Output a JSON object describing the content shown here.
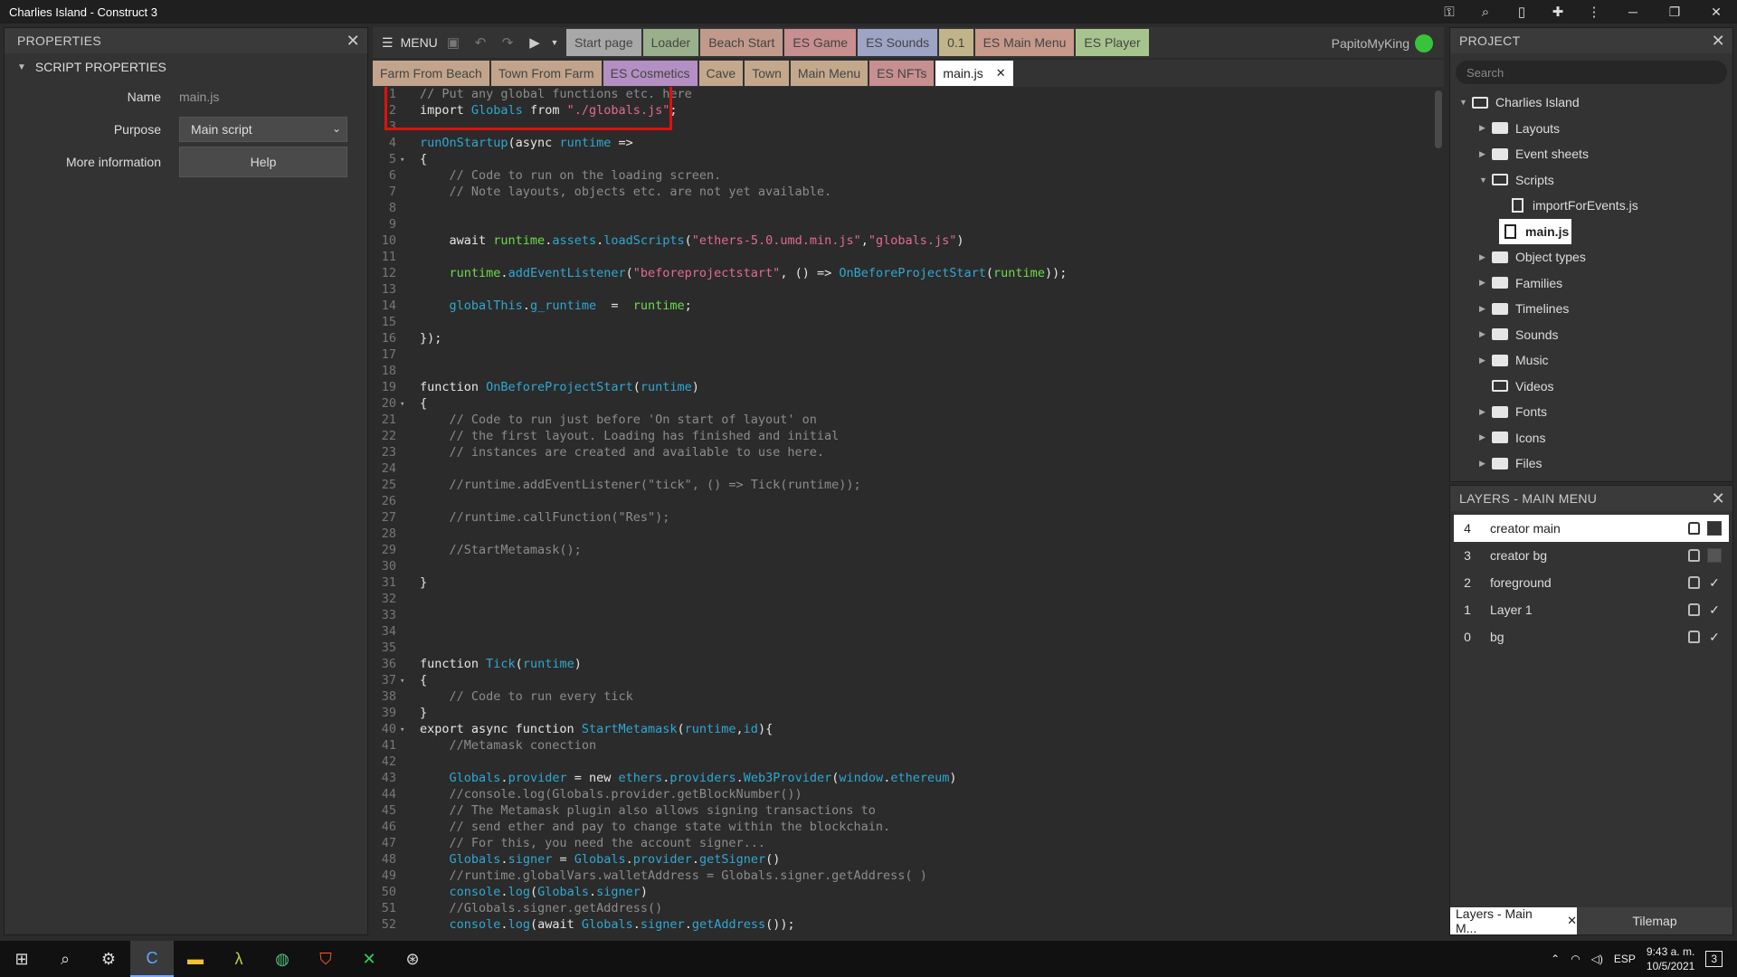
{
  "window": {
    "title": "Charlies Island - Construct 3"
  },
  "properties": {
    "header": "PROPERTIES",
    "section": "SCRIPT PROPERTIES",
    "name_label": "Name",
    "name_value": "main.js",
    "purpose_label": "Purpose",
    "purpose_value": "Main script",
    "more_label": "More information",
    "help_label": "Help"
  },
  "toolbar": {
    "menu_label": "MENU",
    "tabs": [
      {
        "label": "Start page",
        "color": "#a8a8a8"
      },
      {
        "label": "Loader",
        "color": "#9ab08c"
      },
      {
        "label": "Beach Start",
        "color": "#c29a8c"
      },
      {
        "label": "ES Game",
        "color": "#c78f8f"
      },
      {
        "label": "ES Sounds",
        "color": "#9ea4c4"
      },
      {
        "label": "0.1",
        "color": "#c2b48a"
      },
      {
        "label": "ES Main Menu",
        "color": "#c79a8c"
      },
      {
        "label": "ES Player",
        "color": "#a8c48e"
      }
    ],
    "user": "PapitoMyKing"
  },
  "tabs2": [
    {
      "label": "Farm From Beach",
      "color": "#c2a48c",
      "text": "#444"
    },
    {
      "label": "Town From Farm",
      "color": "#c2a48c",
      "text": "#444"
    },
    {
      "label": "ES Cosmetics",
      "color": "#b48fc4",
      "text": "#444"
    },
    {
      "label": "Cave",
      "color": "#c4a88c",
      "text": "#444"
    },
    {
      "label": "Town",
      "color": "#c4a88c",
      "text": "#444"
    },
    {
      "label": "Main Menu",
      "color": "#c4a88c",
      "text": "#444"
    },
    {
      "label": "ES NFTs",
      "color": "#c78f8f",
      "text": "#444"
    }
  ],
  "active_tab": {
    "label": "main.js",
    "close": "✕"
  },
  "code_lines": [
    {
      "n": "1",
      "fold": "",
      "html": "<span class=\"c\">// Put any global functions etc. here</span>"
    },
    {
      "n": "2",
      "fold": "",
      "html": "import <span class=\"f\">Globals</span> from <span class=\"s\">\"./globals.js\"</span>;"
    },
    {
      "n": "3",
      "fold": "",
      "html": ""
    },
    {
      "n": "4",
      "fold": "",
      "html": "<span class=\"f\">runOnStartup</span>(async <span class=\"f\">runtime</span> =&gt;"
    },
    {
      "n": "5",
      "fold": "▾",
      "html": "{"
    },
    {
      "n": "6",
      "fold": "",
      "html": "    <span class=\"c\">// Code to run on the loading screen.</span>"
    },
    {
      "n": "7",
      "fold": "",
      "html": "    <span class=\"c\">// Note layouts, objects etc. are not yet available.</span>"
    },
    {
      "n": "8",
      "fold": "",
      "html": ""
    },
    {
      "n": "9",
      "fold": "",
      "html": ""
    },
    {
      "n": "10",
      "fold": "",
      "html": "    await <span class=\"g\">runtime</span>.<span class=\"f\">assets</span>.<span class=\"f\">loadScripts</span>(<span class=\"s\">\"ethers-5.0.umd.min.js\"</span>,<span class=\"s\">\"globals.js\"</span>)"
    },
    {
      "n": "11",
      "fold": "",
      "html": ""
    },
    {
      "n": "12",
      "fold": "",
      "html": "    <span class=\"g\">runtime</span>.<span class=\"f\">addEventListener</span>(<span class=\"s\">\"beforeprojectstart\"</span>, () =&gt; <span class=\"f\">OnBeforeProjectStart</span>(<span class=\"g\">runtime</span>));"
    },
    {
      "n": "13",
      "fold": "",
      "html": ""
    },
    {
      "n": "14",
      "fold": "",
      "html": "    <span class=\"f\">globalThis</span>.<span class=\"f\">g_runtime</span>  =  <span class=\"g\">runtime</span>;"
    },
    {
      "n": "15",
      "fold": "",
      "html": ""
    },
    {
      "n": "16",
      "fold": "",
      "html": "});"
    },
    {
      "n": "17",
      "fold": "",
      "html": ""
    },
    {
      "n": "18",
      "fold": "",
      "html": ""
    },
    {
      "n": "19",
      "fold": "",
      "html": "function <span class=\"f\">OnBeforeProjectStart</span>(<span class=\"f\">runtime</span>)"
    },
    {
      "n": "20",
      "fold": "▾",
      "html": "{"
    },
    {
      "n": "21",
      "fold": "",
      "html": "    <span class=\"c\">// Code to run just before 'On start of layout' on</span>"
    },
    {
      "n": "22",
      "fold": "",
      "html": "    <span class=\"c\">// the first layout. Loading has finished and initial</span>"
    },
    {
      "n": "23",
      "fold": "",
      "html": "    <span class=\"c\">// instances are created and available to use here.</span>"
    },
    {
      "n": "24",
      "fold": "",
      "html": ""
    },
    {
      "n": "25",
      "fold": "",
      "html": "    <span class=\"c\">//runtime.addEventListener(\"tick\", () =&gt; Tick(runtime));</span>"
    },
    {
      "n": "26",
      "fold": "",
      "html": ""
    },
    {
      "n": "27",
      "fold": "",
      "html": "    <span class=\"c\">//runtime.callFunction(\"Res\");</span>"
    },
    {
      "n": "28",
      "fold": "",
      "html": ""
    },
    {
      "n": "29",
      "fold": "",
      "html": "    <span class=\"c\">//StartMetamask();</span>"
    },
    {
      "n": "30",
      "fold": "",
      "html": ""
    },
    {
      "n": "31",
      "fold": "",
      "html": "}"
    },
    {
      "n": "32",
      "fold": "",
      "html": ""
    },
    {
      "n": "33",
      "fold": "",
      "html": ""
    },
    {
      "n": "34",
      "fold": "",
      "html": ""
    },
    {
      "n": "35",
      "fold": "",
      "html": ""
    },
    {
      "n": "36",
      "fold": "",
      "html": "function <span class=\"f\">Tick</span>(<span class=\"f\">runtime</span>)"
    },
    {
      "n": "37",
      "fold": "▾",
      "html": "{"
    },
    {
      "n": "38",
      "fold": "",
      "html": "    <span class=\"c\">// Code to run every tick</span>"
    },
    {
      "n": "39",
      "fold": "",
      "html": "}"
    },
    {
      "n": "40",
      "fold": "▾",
      "html": "export async function <span class=\"f\">StartMetamask</span>(<span class=\"f\">runtime</span>,<span class=\"f\">id</span>){"
    },
    {
      "n": "41",
      "fold": "",
      "html": "    <span class=\"c\">//Metamask conection</span>"
    },
    {
      "n": "42",
      "fold": "",
      "html": ""
    },
    {
      "n": "43",
      "fold": "",
      "html": "    <span class=\"f\">Globals</span>.<span class=\"f\">provider</span> = new <span class=\"f\">ethers</span>.<span class=\"f\">providers</span>.<span class=\"f\">Web3Provider</span>(<span class=\"f\">window</span>.<span class=\"f\">ethereum</span>)"
    },
    {
      "n": "44",
      "fold": "",
      "html": "    <span class=\"c\">//console.log(Globals.provider.getBlockNumber())</span>"
    },
    {
      "n": "45",
      "fold": "",
      "html": "    <span class=\"c\">// The Metamask plugin also allows signing transactions to</span>"
    },
    {
      "n": "46",
      "fold": "",
      "html": "    <span class=\"c\">// send ether and pay to change state within the blockchain.</span>"
    },
    {
      "n": "47",
      "fold": "",
      "html": "    <span class=\"c\">// For this, you need the account signer...</span>"
    },
    {
      "n": "48",
      "fold": "",
      "html": "    <span class=\"f\">Globals</span>.<span class=\"f\">signer</span> = <span class=\"f\">Globals</span>.<span class=\"f\">provider</span>.<span class=\"f\">getSigner</span>()"
    },
    {
      "n": "49",
      "fold": "",
      "html": "    <span class=\"c\">//runtime.globalVars.walletAddress = Globals.signer.getAddress( )</span>"
    },
    {
      "n": "50",
      "fold": "",
      "html": "    <span class=\"f\">console</span>.<span class=\"f\">log</span>(<span class=\"f\">Globals</span>.<span class=\"f\">signer</span>)"
    },
    {
      "n": "51",
      "fold": "",
      "html": "    <span class=\"c\">//Globals.signer.getAddress()</span>"
    },
    {
      "n": "52",
      "fold": "",
      "html": "    <span class=\"f\">console</span>.<span class=\"f\">log</span>(await <span class=\"f\">Globals</span>.<span class=\"f\">signer</span>.<span class=\"f\">getAddress</span>());"
    }
  ],
  "project": {
    "header": "PROJECT",
    "search_placeholder": "Search",
    "items": [
      {
        "label": "Charlies Island",
        "type": "folder-open",
        "depth": 0,
        "arrow": "▼"
      },
      {
        "label": "Layouts",
        "type": "folder",
        "depth": 1,
        "arrow": "▶"
      },
      {
        "label": "Event sheets",
        "type": "folder",
        "depth": 1,
        "arrow": "▶"
      },
      {
        "label": "Scripts",
        "type": "folder-open",
        "depth": 1,
        "arrow": "▼"
      },
      {
        "label": "importForEvents.js",
        "type": "file",
        "depth": 2,
        "arrow": ""
      },
      {
        "label": "main.js",
        "type": "file",
        "depth": 2,
        "arrow": "",
        "selected": true
      },
      {
        "label": "Object types",
        "type": "folder",
        "depth": 1,
        "arrow": "▶"
      },
      {
        "label": "Families",
        "type": "folder",
        "depth": 1,
        "arrow": "▶"
      },
      {
        "label": "Timelines",
        "type": "folder",
        "depth": 1,
        "arrow": "▶"
      },
      {
        "label": "Sounds",
        "type": "folder",
        "depth": 1,
        "arrow": "▶"
      },
      {
        "label": "Music",
        "type": "folder",
        "depth": 1,
        "arrow": "▶"
      },
      {
        "label": "Videos",
        "type": "folder-open",
        "depth": 1,
        "arrow": ""
      },
      {
        "label": "Fonts",
        "type": "folder",
        "depth": 1,
        "arrow": "▶"
      },
      {
        "label": "Icons",
        "type": "folder",
        "depth": 1,
        "arrow": "▶"
      },
      {
        "label": "Files",
        "type": "folder",
        "depth": 1,
        "arrow": "▶"
      }
    ]
  },
  "layers": {
    "header": "LAYERS - MAIN MENU",
    "rows": [
      {
        "num": "4",
        "name": "creator main",
        "visible": false,
        "selected": true
      },
      {
        "num": "3",
        "name": "creator bg",
        "visible": false,
        "selected": false
      },
      {
        "num": "2",
        "name": "foreground",
        "visible": true,
        "selected": false
      },
      {
        "num": "1",
        "name": "Layer 1",
        "visible": true,
        "selected": false
      },
      {
        "num": "0",
        "name": "bg",
        "visible": true,
        "selected": false
      }
    ],
    "bottom_tab_active": "Layers - Main M...",
    "bottom_tab_other": "Tilemap"
  },
  "taskbar": {
    "lang": "ESP",
    "time": "9:43 a. m.",
    "date": "10/5/2021",
    "notif": "3"
  }
}
